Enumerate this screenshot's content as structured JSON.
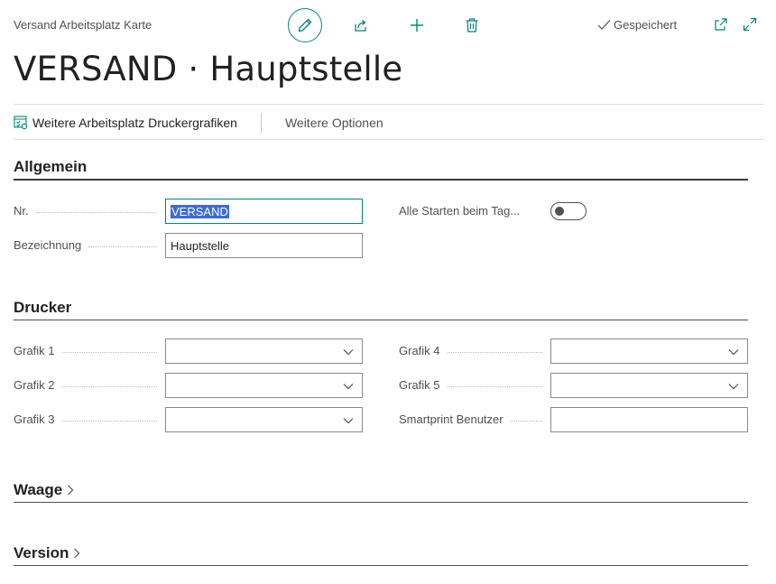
{
  "header": {
    "breadcrumb": "Versand Arbeitsplatz Karte",
    "saved_label": "Gespeichert",
    "title": "VERSAND · Hauptstelle"
  },
  "actions": {
    "primary_label": "Weitere Arbeitsplatz Druckergrafiken",
    "more_label": "Weitere Optionen"
  },
  "general": {
    "title": "Allgemein",
    "nr_label": "Nr.",
    "nr_value": "VERSAND",
    "bezeichnung_label": "Bezeichnung",
    "bezeichnung_value": "Hauptstelle",
    "alle_starten_label": "Alle Starten beim Tag...",
    "alle_starten_on": false
  },
  "printer": {
    "title": "Drucker",
    "grafik1_label": "Grafik 1",
    "grafik2_label": "Grafik 2",
    "grafik3_label": "Grafik 3",
    "grafik4_label": "Grafik 4",
    "grafik5_label": "Grafik 5",
    "smartprint_label": "Smartprint Benutzer"
  },
  "scale": {
    "title": "Waage"
  },
  "version": {
    "title": "Version"
  },
  "colors": {
    "accent": "#00857a",
    "selection": "#3c6bd6",
    "text": "#212121",
    "muted": "#505050"
  }
}
